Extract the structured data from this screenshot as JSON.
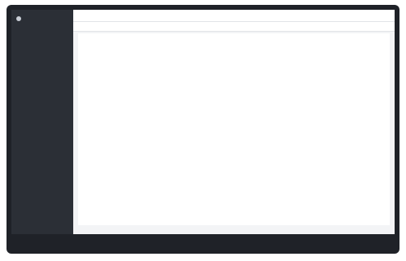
{
  "brand": "",
  "sidebar": [],
  "topbar": {
    "links": [],
    "user": ""
  },
  "tabs": [],
  "document": {
    "title": "",
    "left_lines": [],
    "right_lines": []
  },
  "pager": {
    "pages": [],
    "active": null
  },
  "footer": ""
}
